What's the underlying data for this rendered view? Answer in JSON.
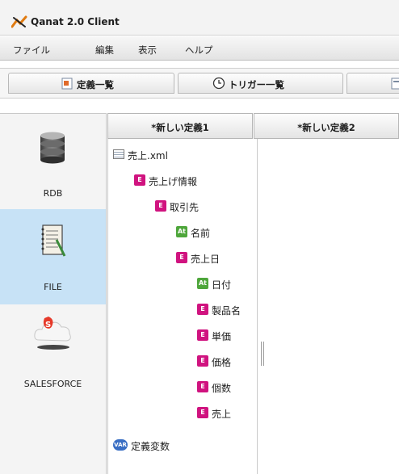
{
  "app": {
    "title": "Qanat 2.0 Client"
  },
  "menu": {
    "items": [
      "ファイル",
      "編集",
      "表示",
      "ヘルプ"
    ]
  },
  "main_tabs": [
    {
      "label": "定義一覧",
      "icon": "document-icon"
    },
    {
      "label": "トリガー一覧",
      "icon": "clock-icon"
    },
    {
      "label": "",
      "icon": "document-icon"
    }
  ],
  "leftnav": {
    "items": [
      {
        "label": "RDB",
        "icon": "database-icon",
        "selected": false
      },
      {
        "label": "FILE",
        "icon": "notebook-icon",
        "selected": true
      },
      {
        "label": "SALESFORCE",
        "icon": "cloud-icon",
        "selected": false
      }
    ]
  },
  "editor_tabs": [
    "*新しい定義1",
    "*新しい定義2"
  ],
  "tree": {
    "root": "売上.xml",
    "nodes": [
      {
        "label": "売上げ情報",
        "kind": "E"
      },
      {
        "label": "取引先",
        "kind": "E"
      },
      {
        "label": "名前",
        "kind": "At"
      },
      {
        "label": "売上日",
        "kind": "E"
      },
      {
        "label": "日付",
        "kind": "At"
      },
      {
        "label": "製品名",
        "kind": "E"
      },
      {
        "label": "単価",
        "kind": "E"
      },
      {
        "label": "価格",
        "kind": "E"
      },
      {
        "label": "個数",
        "kind": "E"
      },
      {
        "label": "売上",
        "kind": "E"
      }
    ],
    "variables": {
      "label": "定義変数",
      "badge": "VAR"
    }
  },
  "colors": {
    "selected_nav": "#c7e2f6",
    "element_badge": "#d0137f",
    "attribute_badge": "#4ea63b",
    "variable_badge": "#3a6fc4"
  }
}
